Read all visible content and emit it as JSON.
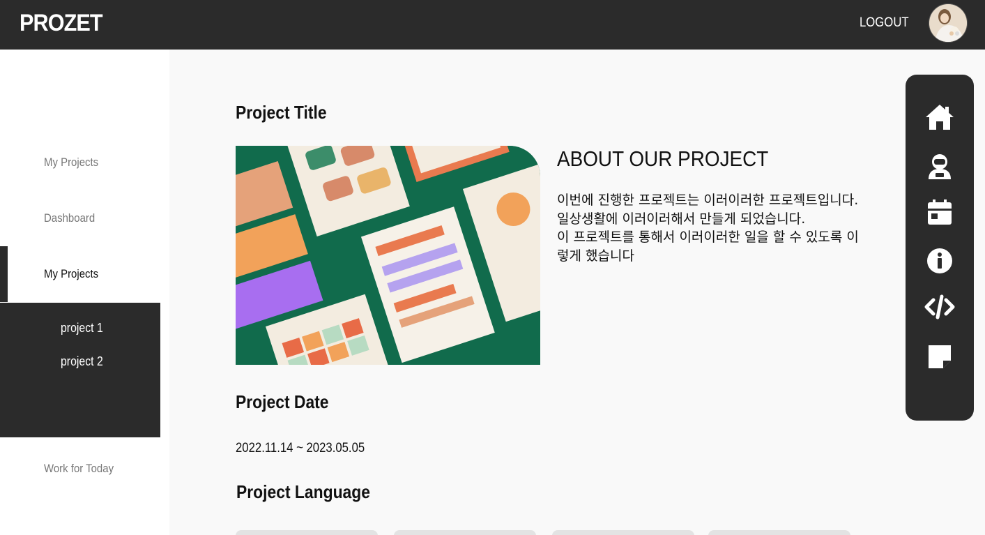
{
  "header": {
    "brand": "PROZET",
    "logout_label": "LOGOUT"
  },
  "sidebar": {
    "items": [
      {
        "label": "My Projects"
      },
      {
        "label": "Dashboard"
      },
      {
        "label": "My Projects",
        "active": true
      },
      {
        "label": "Work for Today"
      }
    ],
    "submenu": [
      {
        "label": "project 1"
      },
      {
        "label": "project 2"
      }
    ]
  },
  "main": {
    "project_title": "Project Title",
    "about": {
      "heading": "ABOUT OUR PROJECT",
      "lines": [
        "이번에 진행한 프로젝트는 이러이러한 프로젝트입니다.",
        "일상생활에 이러이러해서 만들게 되었습니다.",
        "이 프로젝트를 통해서 이러이러한 일을 할 수 있도록 이렇게 했습니다"
      ]
    },
    "date_heading": "Project Date",
    "date_range": "2022.11.14 ~ 2023.05.05",
    "language_heading": "Project Language"
  },
  "right_toolbar": {
    "icons": [
      "home-icon",
      "astronaut-icon",
      "calendar-icon",
      "info-icon",
      "code-icon",
      "note-icon"
    ]
  },
  "colors": {
    "dark": "#2b2b2b",
    "page_bg": "#f9f9f9",
    "white": "#ffffff",
    "muted_text": "#777777"
  }
}
